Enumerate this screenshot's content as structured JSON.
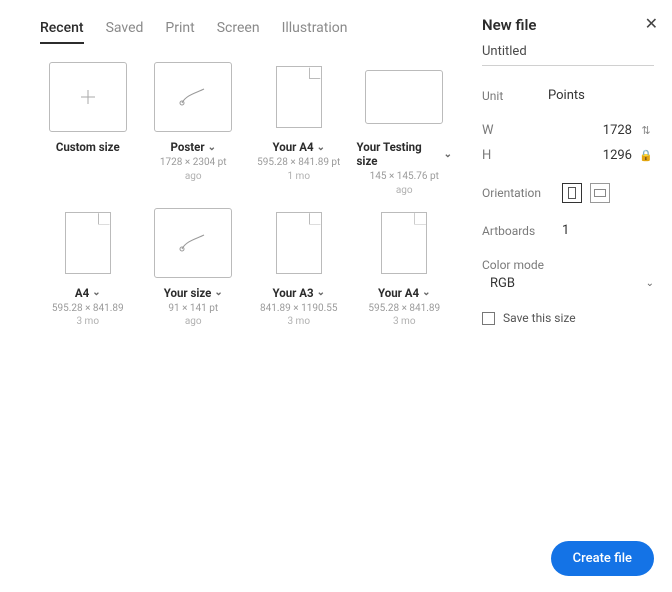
{
  "header": {
    "title": "New file",
    "file_name": "Untitled"
  },
  "tabs": [
    {
      "label": "Recent",
      "active": true
    },
    {
      "label": "Saved",
      "active": false
    },
    {
      "label": "Print",
      "active": false
    },
    {
      "label": "Screen",
      "active": false
    },
    {
      "label": "Illustration",
      "active": false
    }
  ],
  "presets": [
    {
      "name": "Custom size",
      "meta1": "",
      "meta2": "",
      "shape": "plus",
      "hasChevron": false
    },
    {
      "name": "Poster",
      "meta1": "1728 × 2304 pt",
      "meta2": "ago",
      "shape": "poster",
      "hasChevron": true
    },
    {
      "name": "Your A4",
      "meta1": "595.28 × 841.89 pt",
      "meta2": "1 mo",
      "shape": "page",
      "hasChevron": true
    },
    {
      "name": "Your Testing size",
      "meta1": "145 × 145.76 pt",
      "meta2": "ago",
      "shape": "wide",
      "hasChevron": true
    },
    {
      "name": "A4",
      "meta1": "595.28 × 841.89",
      "meta2": "3 mo",
      "shape": "page",
      "hasChevron": true
    },
    {
      "name": "Your size",
      "meta1": "91 × 141 pt",
      "meta2": "ago",
      "shape": "poster",
      "hasChevron": true
    },
    {
      "name": "Your A3",
      "meta1": "841.89 × 1190.55",
      "meta2": "3 mo",
      "shape": "page",
      "hasChevron": true
    },
    {
      "name": "Your A4",
      "meta1": "595.28 × 841.89",
      "meta2": "3 mo",
      "shape": "page",
      "hasChevron": true
    }
  ],
  "form": {
    "unit_label": "Unit",
    "unit_value": "Points",
    "w_label": "W",
    "w_value": "1728",
    "h_label": "H",
    "h_value": "1296",
    "orientation_label": "Orientation",
    "artboards_label": "Artboards",
    "artboards_value": "1",
    "color_mode_label": "Color mode",
    "color_mode_value": "RGB",
    "save_size_label": "Save this size"
  },
  "actions": {
    "create": "Create file"
  }
}
